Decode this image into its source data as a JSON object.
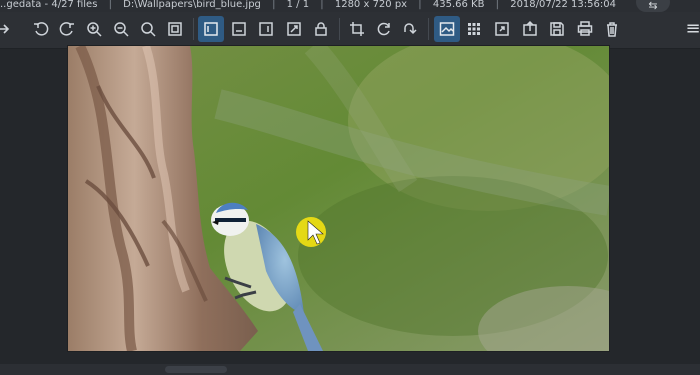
{
  "titlebar": {
    "parts": [
      "..gedata - 4/27 files",
      "D:\\Wallpapers\\bird_blue.jpg",
      "1 / 1",
      "1280 x 720 px",
      "435.66 KB",
      "2018/07/22 13:56:04"
    ],
    "controls": {
      "restore": "⇆",
      "menu": "≡"
    }
  },
  "toolbar": {
    "groups": [
      {
        "name": "navigation",
        "items": [
          "back",
          "rotate-left",
          "rotate-right",
          "zoom-in",
          "zoom-out",
          "zoom-reset",
          "fit-to-window"
        ]
      },
      {
        "name": "view-modes",
        "items": [
          "view-normal",
          "view-fit-width",
          "view-fit-height",
          "view-full",
          "lock"
        ]
      },
      {
        "name": "editing",
        "items": [
          "crop",
          "refresh",
          "redo"
        ]
      },
      {
        "name": "panels",
        "items": [
          "image-info",
          "thumbnails",
          "resize",
          "share",
          "save",
          "print",
          "delete"
        ]
      }
    ]
  },
  "colors": {
    "accent": "#2f5b84",
    "background": "#26292d",
    "toolbar": "#2d3035",
    "cursor_highlight": "#f3e112"
  },
  "photo": {
    "subject": "blue tit perched on tree trunk",
    "cursor": "yellow-circle pointer"
  }
}
